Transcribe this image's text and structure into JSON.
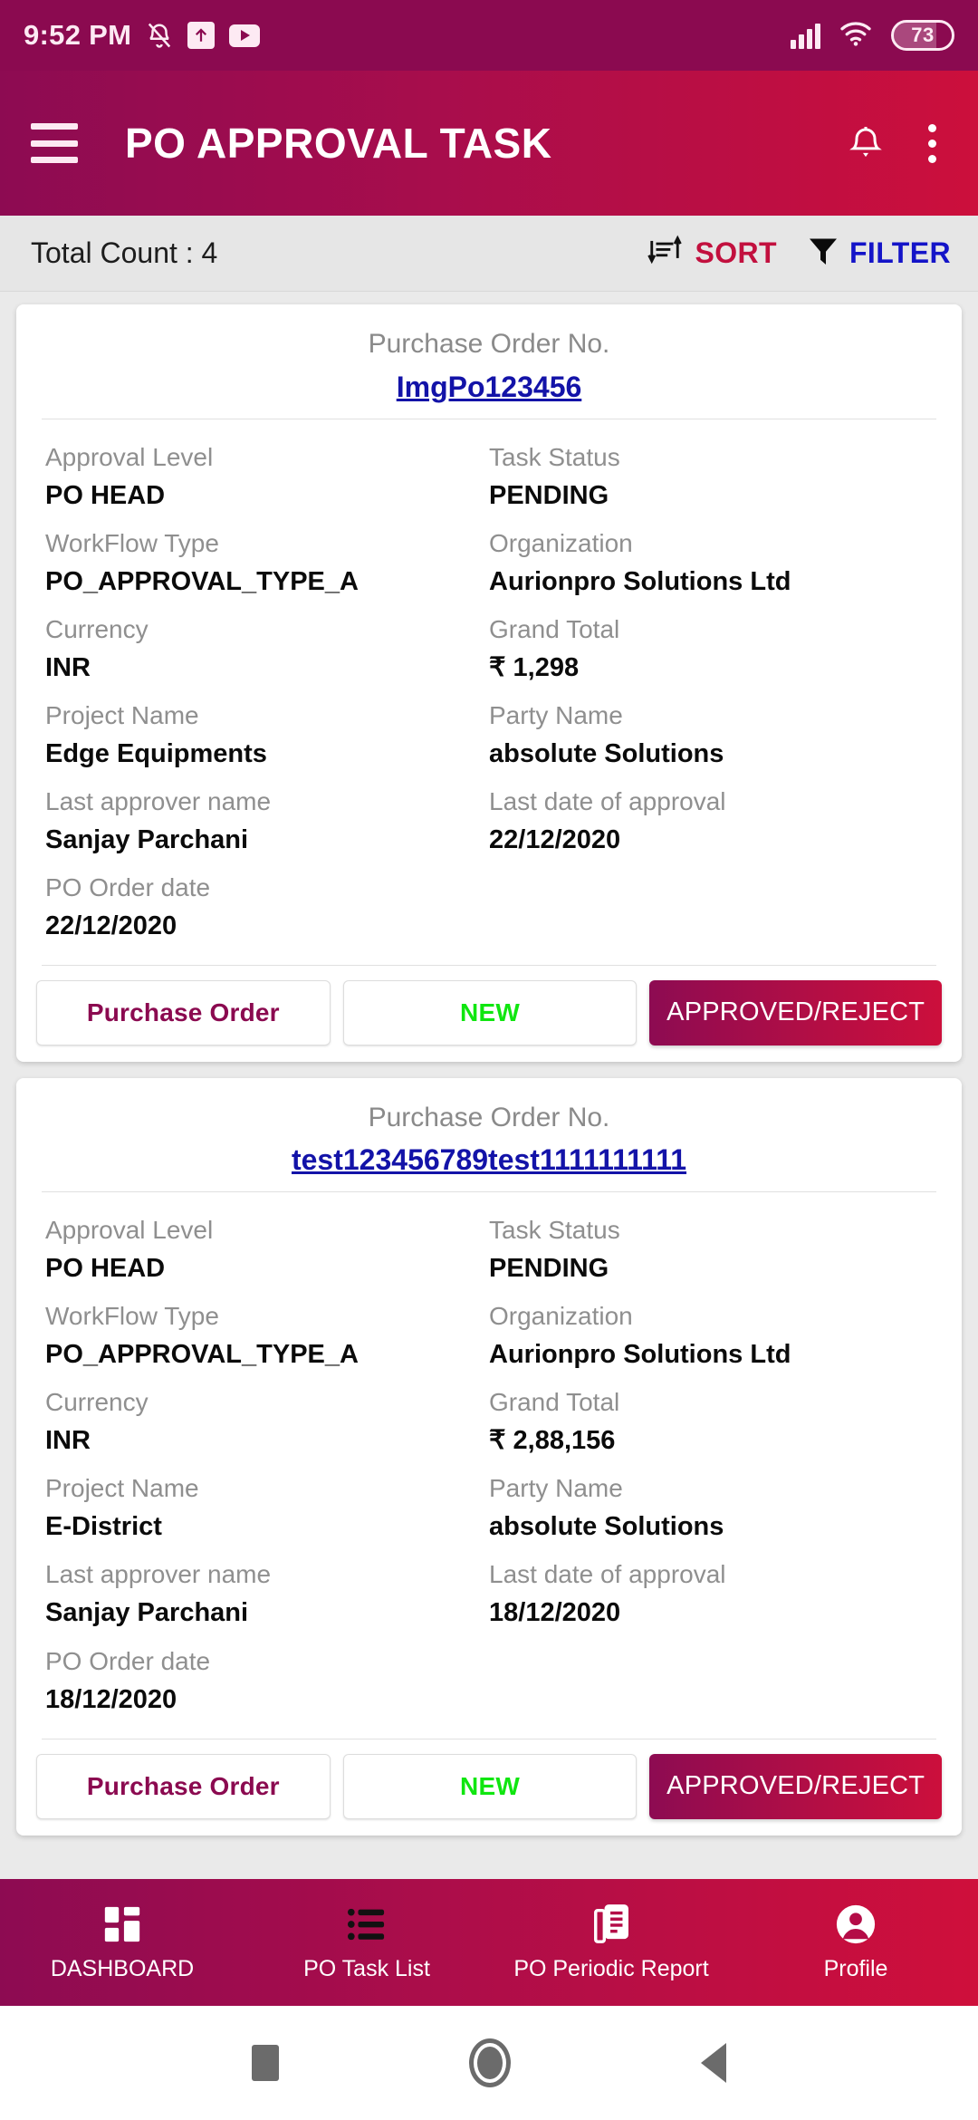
{
  "status_bar": {
    "time": "9:52 PM",
    "battery_percent": "73",
    "icons": [
      "mute-icon",
      "upload-icon",
      "youtube-icon",
      "signal-icon",
      "wifi-icon",
      "battery-icon"
    ]
  },
  "app_bar": {
    "title": "PO APPROVAL TASK",
    "menu_icon": "hamburger-icon",
    "notification_icon": "bell-icon",
    "overflow_icon": "kebab-menu-icon"
  },
  "count_bar": {
    "count_text": "Total Count : 4",
    "sort_label": "SORT",
    "filter_label": "FILTER",
    "sort_color": "#c2103e",
    "filter_color": "#1414c8"
  },
  "card_labels": {
    "po_no": "Purchase Order No.",
    "approval_level": "Approval Level",
    "task_status": "Task Status",
    "workflow_type": "WorkFlow Type",
    "organization": "Organization",
    "currency": "Currency",
    "grand_total": "Grand Total",
    "project_name": "Project Name",
    "party_name": "Party Name",
    "last_approver_name": "Last approver name",
    "last_date_of_approval": "Last date of approval",
    "po_order_date": "PO Order date"
  },
  "card_buttons": {
    "purchase_order": "Purchase Order",
    "new": "NEW",
    "approved_reject": "APPROVED/REJECT"
  },
  "cards": [
    {
      "po_no": "ImgPo123456",
      "approval_level": "PO HEAD",
      "task_status": "PENDING",
      "workflow_type": "PO_APPROVAL_TYPE_A",
      "organization": "Aurionpro Solutions Ltd",
      "currency": "INR",
      "grand_total": "₹ 1,298",
      "project_name": "Edge Equipments",
      "party_name": "absolute Solutions",
      "last_approver_name": "Sanjay Parchani",
      "last_date_of_approval": "22/12/2020",
      "po_order_date": "22/12/2020"
    },
    {
      "po_no": "test123456789test1111111111",
      "approval_level": "PO HEAD",
      "task_status": "PENDING",
      "workflow_type": "PO_APPROVAL_TYPE_A",
      "organization": "Aurionpro Solutions Ltd",
      "currency": "INR",
      "grand_total": "₹ 2,88,156",
      "project_name": "E-District",
      "party_name": "absolute Solutions",
      "last_approver_name": "Sanjay Parchani",
      "last_date_of_approval": "18/12/2020",
      "po_order_date": "18/12/2020"
    }
  ],
  "bottom_nav": {
    "items": [
      {
        "label": "DASHBOARD",
        "icon": "dashboard-grid-icon"
      },
      {
        "label": "PO Task List",
        "icon": "list-icon"
      },
      {
        "label": "PO Periodic Report",
        "icon": "report-document-icon"
      },
      {
        "label": "Profile",
        "icon": "person-icon"
      }
    ]
  },
  "android_nav": {
    "recents": "recents-square-icon",
    "home": "home-circle-icon",
    "back": "back-triangle-icon"
  },
  "theme": {
    "brand_dark": "#8d0b52",
    "brand_light": "#cc0f3c",
    "status_bar_bg": "#8b0a50",
    "link_blue": "#1313a8",
    "new_green": "#10e610"
  }
}
